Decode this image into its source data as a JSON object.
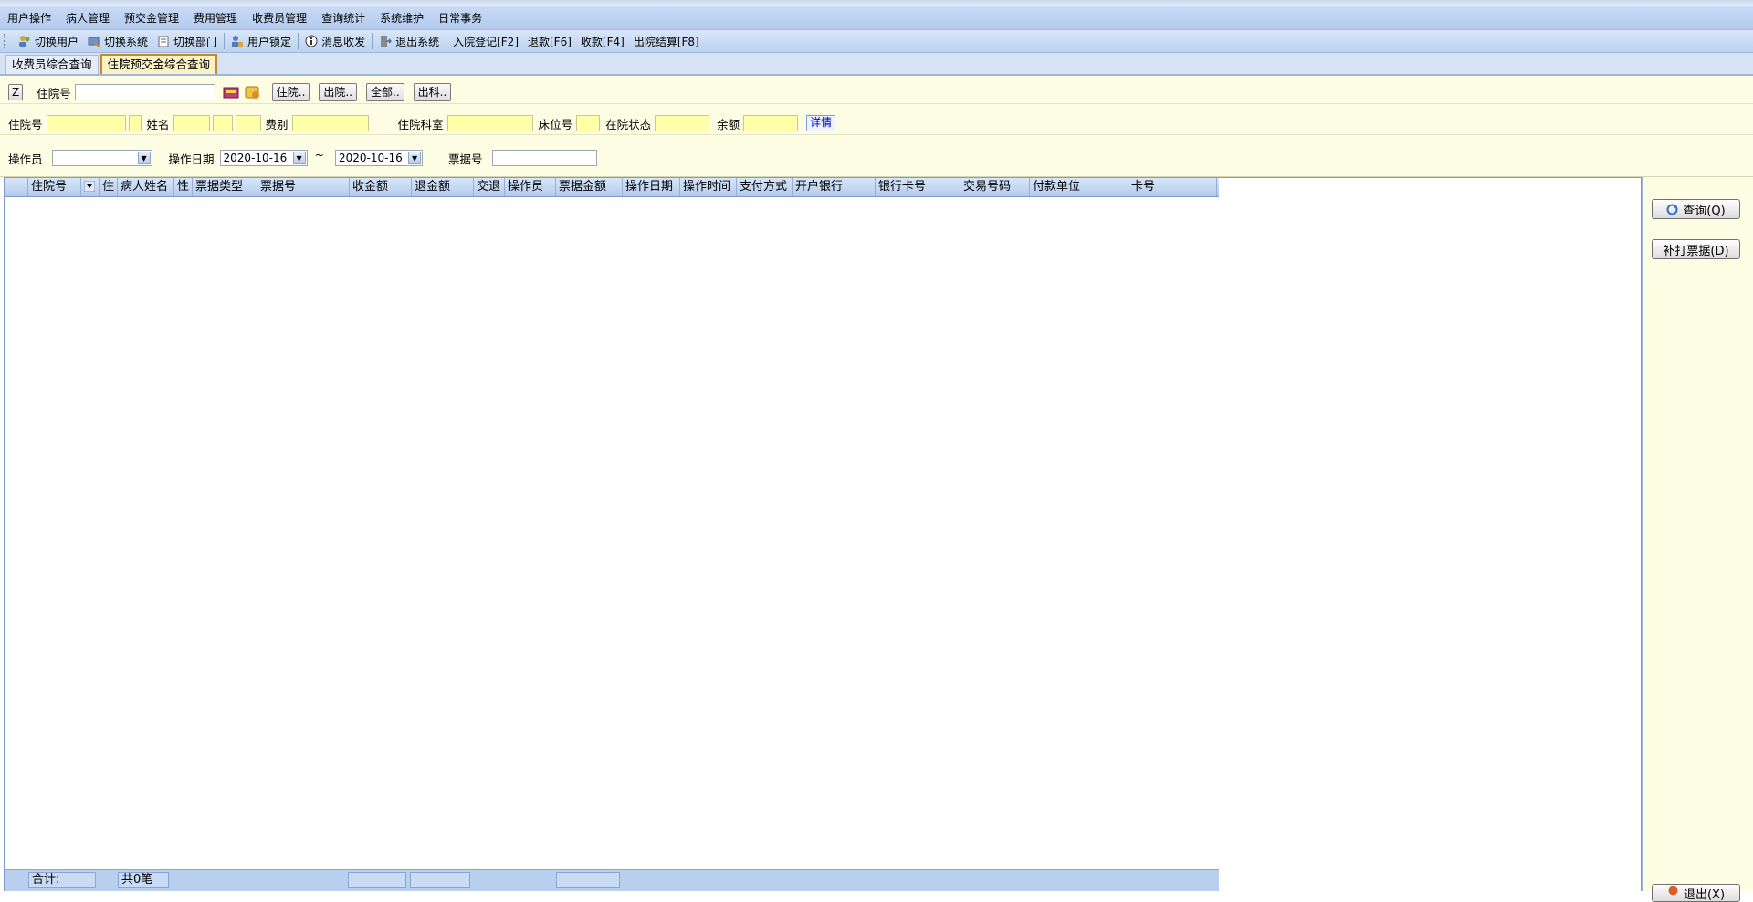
{
  "menu": [
    "用户操作",
    "病人管理",
    "预交金管理",
    "费用管理",
    "收费员管理",
    "查询统计",
    "系统维护",
    "日常事务"
  ],
  "toolbar": {
    "switch_user": "切换用户",
    "switch_system": "切换系统",
    "switch_dept": "切换部门",
    "user_lock": "用户锁定",
    "message": "消息收发",
    "exit": "退出系统",
    "admit": "入院登记[F2]",
    "refund": "退款[F6]",
    "collect": "收款[F4]",
    "discharge": "出院结算[F8]"
  },
  "tabs": [
    "收费员综合查询",
    "住院预交金综合查询"
  ],
  "filters": {
    "z_button": "Z",
    "inpatient_no_label": "住院号",
    "inpatient_no_value": "",
    "btn_in": "住院..",
    "btn_out": "出院..",
    "btn_all": "全部..",
    "btn_outsection": "出科..",
    "row2": {
      "inpatient_no": "住院号",
      "name": "姓名",
      "fee_type": "费别",
      "dept": "住院科室",
      "bed": "床位号",
      "status": "在院状态",
      "balance": "余额",
      "detail": "详情"
    },
    "operator_label": "操作员",
    "operator_value": "",
    "date_label": "操作日期",
    "date_from": "2020-10-16",
    "tilde": "~",
    "date_to": "2020-10-16",
    "receipt_label": "票据号"
  },
  "grid": {
    "columns": [
      "住院号",
      "住",
      "病人姓名",
      "性",
      "票据类型",
      "票据号",
      "收金额",
      "退金额",
      "交退",
      "操作员",
      "票据金额",
      "操作日期",
      "操作时间",
      "支付方式",
      "开户银行",
      "银行卡号",
      "交易号码",
      "付款单位",
      "卡号"
    ],
    "footer_total": "合计:",
    "footer_count": "共0笔"
  },
  "side": {
    "query": "查询(Q)",
    "reprint": "补打票据(D)",
    "exit": "退出(X)"
  }
}
